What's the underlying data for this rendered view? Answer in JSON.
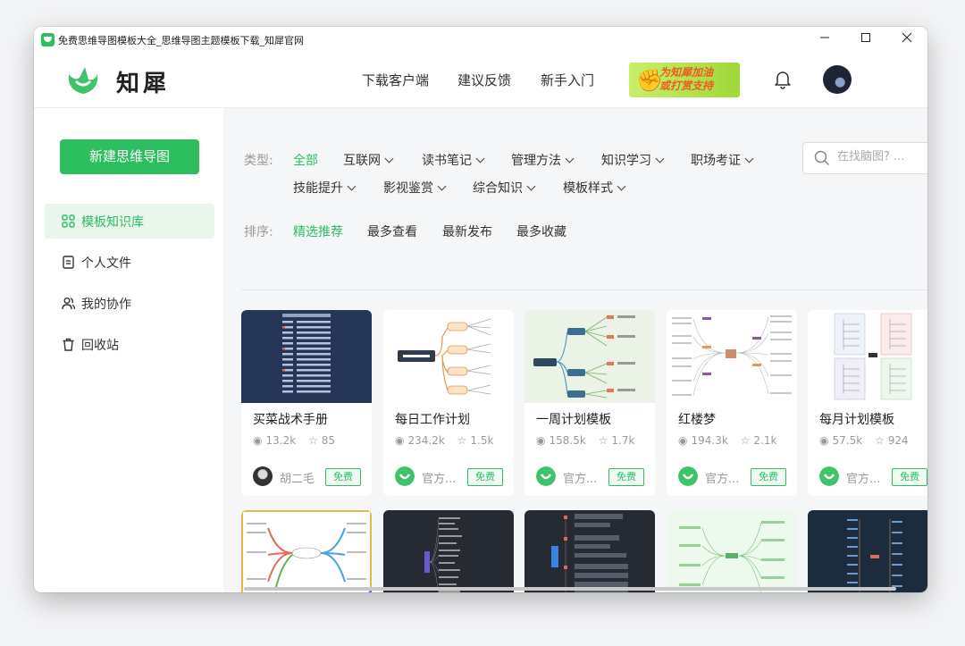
{
  "window": {
    "title": "免费思维导图模板大全_思维导图主题模板下载_知犀官网"
  },
  "brand": {
    "name": "知犀"
  },
  "nav": {
    "links": [
      "下载客户端",
      "建议反馈",
      "新手入门"
    ],
    "promo": "为知犀加油\n或打赏支持"
  },
  "sidebar": {
    "new_button": "新建思维导图",
    "items": [
      {
        "label": "模板知识库",
        "icon": "grid-icon"
      },
      {
        "label": "个人文件",
        "icon": "file-icon"
      },
      {
        "label": "我的协作",
        "icon": "users-icon"
      },
      {
        "label": "回收站",
        "icon": "trash-icon"
      }
    ]
  },
  "filters": {
    "type_label": "类型:",
    "types": [
      "全部",
      "互联网",
      "读书笔记",
      "管理方法",
      "知识学习",
      "职场考证",
      "技能提升",
      "影视鉴赏",
      "综合知识",
      "模板样式"
    ],
    "sort_label": "排序:",
    "sorts": [
      "精选推荐",
      "最多查看",
      "最新发布",
      "最多收藏"
    ]
  },
  "search": {
    "placeholder": "在找脑图? ..."
  },
  "colors": {
    "accent": "#2dbe60"
  },
  "cards": [
    {
      "title": "买菜战术手册",
      "views": "13.2k",
      "stars": "85",
      "author": "胡二毛",
      "badge": "免费"
    },
    {
      "title": "每日工作计划",
      "views": "234.2k",
      "stars": "1.5k",
      "author": "官方...",
      "badge": "免费"
    },
    {
      "title": "一周计划模板",
      "views": "158.5k",
      "stars": "1.7k",
      "author": "官方...",
      "badge": "免费"
    },
    {
      "title": "红楼梦",
      "views": "194.3k",
      "stars": "2.1k",
      "author": "官方...",
      "badge": "免费"
    },
    {
      "title": "每月计划模板",
      "views": "57.5k",
      "stars": "924",
      "author": "官方...",
      "badge": "免费"
    }
  ]
}
